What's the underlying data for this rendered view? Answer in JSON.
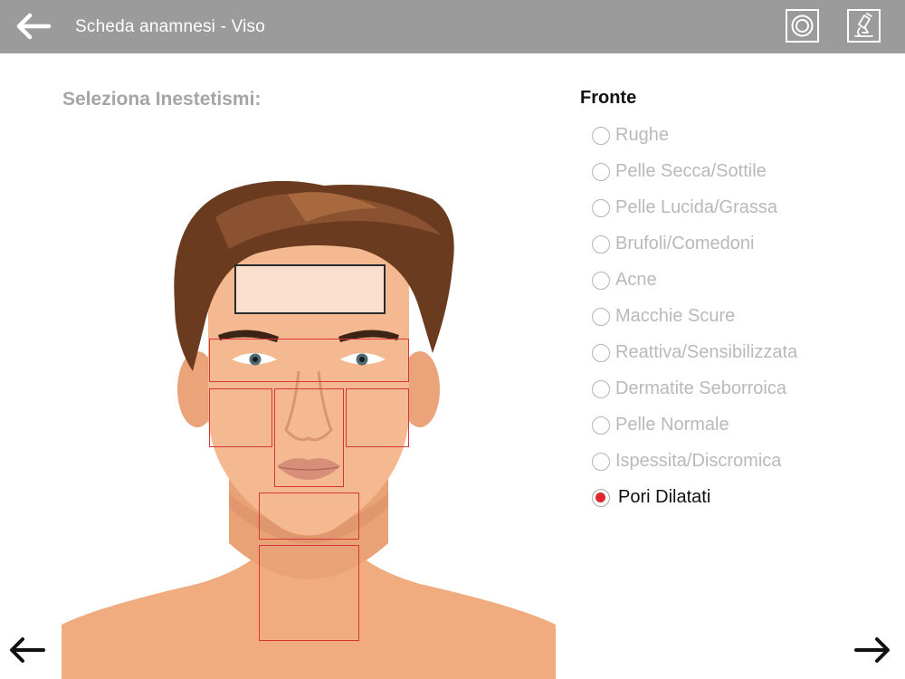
{
  "header": {
    "title": "Scheda anamnesi - Viso",
    "back_icon": "back-arrow-icon",
    "tools": [
      "target-icon",
      "microscope-icon"
    ]
  },
  "main": {
    "heading": "Seleziona Inestetismi:"
  },
  "face_map": {
    "zones": [
      "fronte",
      "occhi",
      "guancia-destra",
      "naso",
      "guancia-sinistra",
      "mento",
      "collo"
    ],
    "selected_zone": "fronte"
  },
  "panel": {
    "section_title": "Fronte",
    "options": [
      {
        "label": "Rughe",
        "checked": false
      },
      {
        "label": "Pelle Secca/Sottile",
        "checked": false
      },
      {
        "label": "Pelle Lucida/Grassa",
        "checked": false
      },
      {
        "label": "Brufoli/Comedoni",
        "checked": false
      },
      {
        "label": "Acne",
        "checked": false
      },
      {
        "label": "Macchie Scure",
        "checked": false
      },
      {
        "label": "Reattiva/Sensibilizzata",
        "checked": false
      },
      {
        "label": "Dermatite Seborroica",
        "checked": false
      },
      {
        "label": "Pelle Normale",
        "checked": false
      },
      {
        "label": "Ispessita/Discromica",
        "checked": false
      },
      {
        "label": "Pori Dilatati",
        "checked": true
      }
    ]
  },
  "footer": {
    "prev_icon": "arrow-left-icon",
    "next_icon": "arrow-right-icon"
  },
  "colors": {
    "header_bg": "#9b9b9b",
    "selected_radio": "#e1262e",
    "zone_border": "#d8343a"
  }
}
